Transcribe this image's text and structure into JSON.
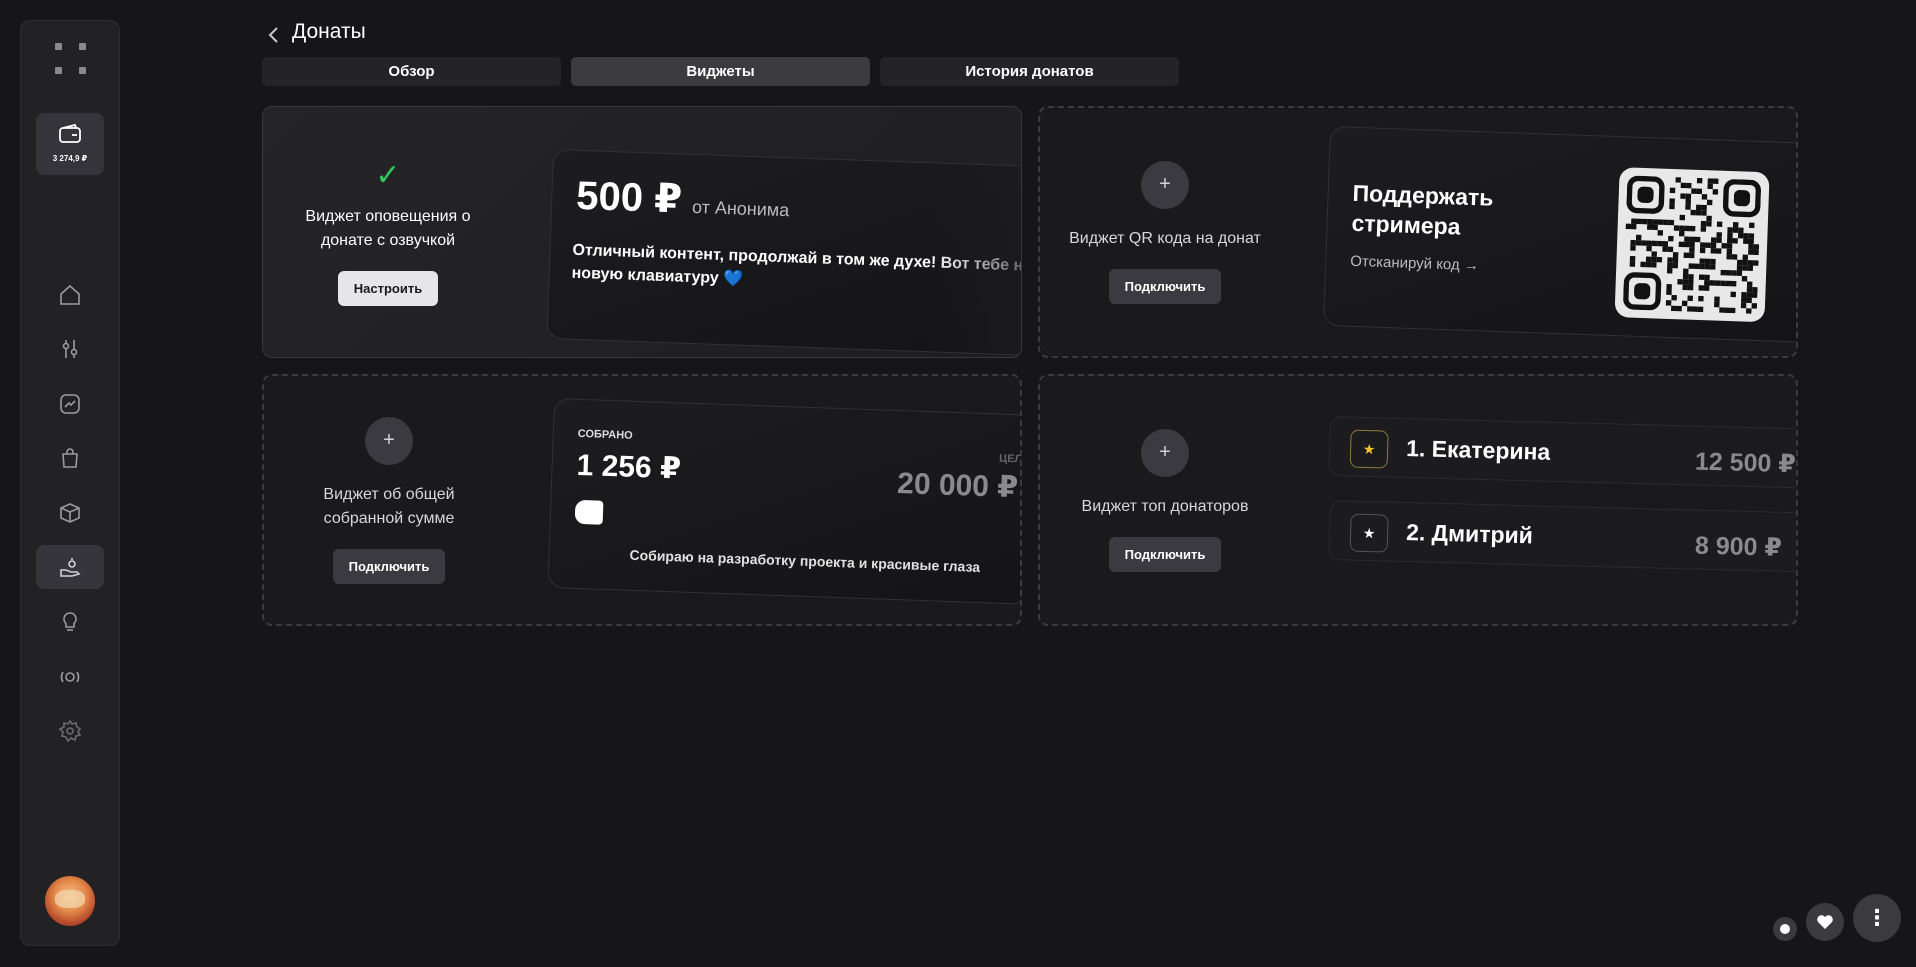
{
  "sidebar": {
    "wallet_amount": "3 274,9 ₽",
    "nav": [
      {
        "icon": "home-icon"
      },
      {
        "icon": "sliders-icon"
      },
      {
        "icon": "chart-icon"
      },
      {
        "icon": "bag-icon"
      },
      {
        "icon": "box-icon"
      },
      {
        "icon": "donate-hand-icon",
        "active": true
      },
      {
        "icon": "lightbulb-icon"
      },
      {
        "icon": "broadcast-icon"
      },
      {
        "icon": "gear-icon"
      }
    ]
  },
  "header": {
    "title": "Донаты"
  },
  "tabs": [
    {
      "label": "Обзор",
      "active": false
    },
    {
      "label": "Виджеты",
      "active": true
    },
    {
      "label": "История донатов",
      "active": false
    }
  ],
  "widgets": {
    "alert": {
      "label": "Виджет оповещения о донате с озвучкой",
      "button": "Настроить",
      "preview": {
        "amount": "500 ₽",
        "from": "от Анонима",
        "message": "Отличный контент, продолжай в том же духе! Вот тебе на новую клавиатуру 💙"
      }
    },
    "qr": {
      "label": "Виджет QR кода на донат",
      "button": "Подключить",
      "preview": {
        "title": "Поддержать стримера",
        "scan": "Отсканируй код"
      }
    },
    "sum": {
      "label": "Виджет об общей собранной сумме",
      "button": "Подключить",
      "preview": {
        "collected_label": "СОБРАНО",
        "collected": "1 256 ₽",
        "goal_label": "ЦЕЛЬ",
        "goal": "20 000 ₽",
        "description": "Собираю на разработку проекта и красивые глаза",
        "progress_fraction": 0.063
      }
    },
    "top": {
      "label": "Виджет топ донаторов",
      "button": "Подключить",
      "preview": {
        "rows": [
          {
            "name": "1. Екатерина",
            "value": "12 500 ₽"
          },
          {
            "name": "2. Дмитрий",
            "value": "8 900 ₽"
          }
        ]
      }
    }
  },
  "colors": {
    "background": "#161618",
    "accent_check": "#2fc85a",
    "star_gold": "#f2c230",
    "heart_blue": "#3b82f6"
  }
}
